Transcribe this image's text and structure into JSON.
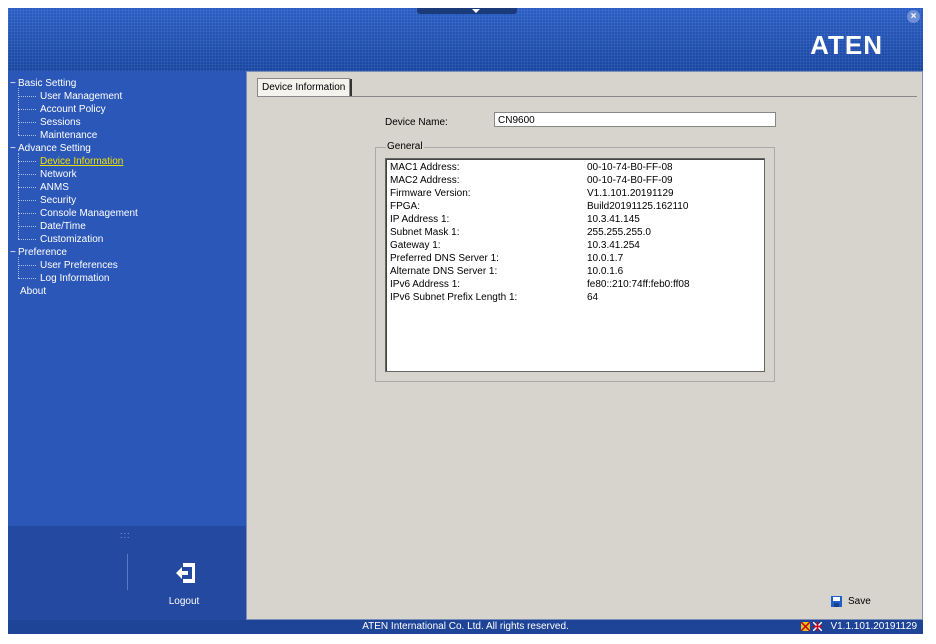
{
  "header": {
    "logo": "ATEN"
  },
  "sidebar": {
    "tree": [
      {
        "label": "Basic Setting",
        "level": 0,
        "toggle": "−"
      },
      {
        "label": "User Management",
        "level": 1
      },
      {
        "label": "Account Policy",
        "level": 1
      },
      {
        "label": "Sessions",
        "level": 1
      },
      {
        "label": "Maintenance",
        "level": 1
      },
      {
        "label": "Advance Setting",
        "level": 0,
        "toggle": "−"
      },
      {
        "label": "Device Information",
        "level": 1,
        "active": true
      },
      {
        "label": "Network",
        "level": 1
      },
      {
        "label": "ANMS",
        "level": 1
      },
      {
        "label": "Security",
        "level": 1
      },
      {
        "label": "Console Management",
        "level": 1
      },
      {
        "label": "Date/Time",
        "level": 1
      },
      {
        "label": "Customization",
        "level": 1
      },
      {
        "label": "Preference",
        "level": 0,
        "toggle": "−"
      },
      {
        "label": "User Preferences",
        "level": 1
      },
      {
        "label": "Log Information",
        "level": 1
      },
      {
        "label": "About",
        "level": 0
      }
    ],
    "grip": ":::",
    "logout_label": "Logout"
  },
  "main": {
    "tab_label": "Device Information",
    "device_name_label": "Device Name:",
    "device_name_value": "CN9600",
    "general_label": "General",
    "info": [
      {
        "key": "MAC1 Address:",
        "value": "00-10-74-B0-FF-08"
      },
      {
        "key": "MAC2 Address:",
        "value": "00-10-74-B0-FF-09"
      },
      {
        "key": "Firmware Version:",
        "value": "V1.1.101.20191129"
      },
      {
        "key": "FPGA:",
        "value": "Build20191125.162110"
      },
      {
        "key": "IP Address 1:",
        "value": "10.3.41.145"
      },
      {
        "key": "Subnet Mask 1:",
        "value": "255.255.255.0"
      },
      {
        "key": "Gateway 1:",
        "value": "10.3.41.254"
      },
      {
        "key": "Preferred DNS Server 1:",
        "value": "10.0.1.7"
      },
      {
        "key": "Alternate DNS Server 1:",
        "value": "10.0.1.6"
      },
      {
        "key": "IPv6 Address 1:",
        "value": "fe80::210:74ff:feb0:ff08"
      },
      {
        "key": "IPv6 Subnet Prefix Length 1:",
        "value": "64"
      }
    ],
    "save_label": "Save"
  },
  "footer": {
    "copyright": "ATEN International Co. Ltd. All rights reserved.",
    "version": "V1.1.101.20191129"
  },
  "colors": {
    "header_blue": "#1d4aa8",
    "sidebar_blue": "#2b57b8",
    "active_link": "#f0e000",
    "panel_bg": "#d6d4cc"
  },
  "icons": {
    "close": "close-icon",
    "logout": "logout-icon",
    "save": "floppy-disk-icon",
    "flags": "language-flag-icon"
  }
}
